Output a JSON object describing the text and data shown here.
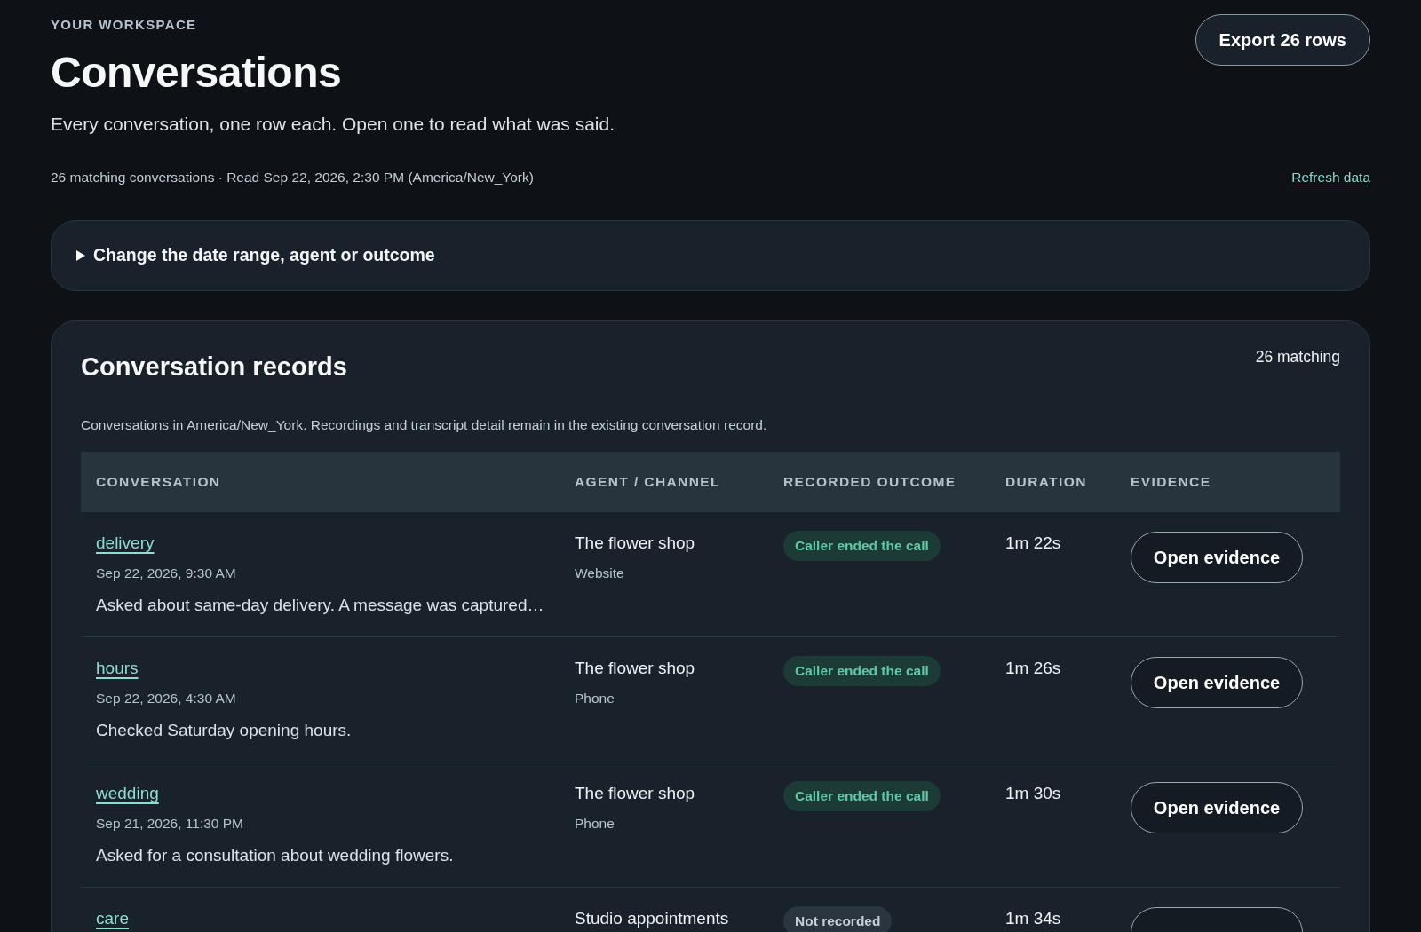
{
  "header": {
    "eyebrow": "YOUR WORKSPACE",
    "title": "Conversations",
    "subtitle": "Every conversation, one row each. Open one to read what was said.",
    "meta": "26 matching conversations · Read Sep 22, 2026, 2:30 PM (America/New_York)",
    "export_button": "Export 26 rows",
    "refresh_link": "Refresh data"
  },
  "filters": {
    "label": "Change the date range, agent or outcome",
    "expanded": false
  },
  "records": {
    "title": "Conversation records",
    "count": "26 matching",
    "description": "Conversations in America/New_York. Recordings and transcript detail remain in the existing conversation record.",
    "columns": [
      "CONVERSATION",
      "AGENT / CHANNEL",
      "RECORDED OUTCOME",
      "DURATION",
      "EVIDENCE"
    ],
    "rows": [
      {
        "topic": "delivery",
        "time": "Sep 22, 2026, 9:30 AM",
        "summary": "Asked about same-day delivery. A message was captured…",
        "agent": "The flower shop",
        "channel": "Website",
        "outcome": {
          "kind": "ended",
          "label": "Caller ended the call"
        },
        "duration": "1m 22s",
        "action": "Open evidence"
      },
      {
        "topic": "hours",
        "time": "Sep 22, 2026, 4:30 AM",
        "summary": "Checked Saturday opening hours.",
        "agent": "The flower shop",
        "channel": "Phone",
        "outcome": {
          "kind": "ended",
          "label": "Caller ended the call"
        },
        "duration": "1m 26s",
        "action": "Open evidence"
      },
      {
        "topic": "wedding",
        "time": "Sep 21, 2026, 11:30 PM",
        "summary": "Asked for a consultation about wedding flowers.",
        "agent": "The flower shop",
        "channel": "Phone",
        "outcome": {
          "kind": "ended",
          "label": "Caller ended the call"
        },
        "duration": "1m 30s",
        "action": "Open evidence"
      },
      {
        "topic": "care",
        "agent": "Studio appointments",
        "outcome": {
          "kind": "not_recorded",
          "label": "Not recorded"
        },
        "duration": "1m 34s"
      }
    ]
  }
}
